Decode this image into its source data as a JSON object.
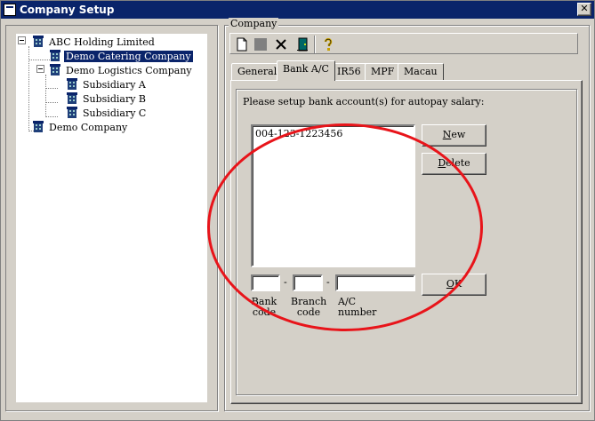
{
  "window": {
    "title": "Company Setup",
    "close_glyph": "✕",
    "colors": {
      "titlebar": "#0a246a",
      "face": "#d4d0c8",
      "annotation": "#e8141a"
    }
  },
  "tree": {
    "items": [
      {
        "label": "ABC Holding Limited",
        "icon": "building-icon",
        "expanded": true
      },
      {
        "label": "Demo Catering Company",
        "icon": "building-icon",
        "selected": true
      },
      {
        "label": "Demo Logistics Company",
        "icon": "building-icon",
        "expanded": true
      },
      {
        "label": "Subsidiary A",
        "icon": "building-icon"
      },
      {
        "label": "Subsidiary B",
        "icon": "building-icon"
      },
      {
        "label": "Subsidiary C",
        "icon": "building-icon"
      },
      {
        "label": "Demo Company",
        "icon": "building-icon"
      }
    ]
  },
  "company_group": {
    "label": "Company",
    "toolbar": [
      "new-document-icon",
      "save-icon",
      "delete-icon",
      "exit-door-icon",
      "help-key-icon"
    ]
  },
  "tabs": [
    {
      "label": "General"
    },
    {
      "label": "Bank A/C",
      "active": true
    },
    {
      "label": "IR56"
    },
    {
      "label": "MPF"
    },
    {
      "label": "Macau"
    }
  ],
  "bank": {
    "instruction": "Please setup bank account(s) for autopay salary:",
    "accounts": [
      "004-123-1223456"
    ],
    "new_button": {
      "accel": "N",
      "rest": "ew"
    },
    "delete_button": {
      "accel": "D",
      "rest": "elete"
    },
    "ok_button": {
      "accel": "O",
      "rest": "K"
    },
    "separator": "-",
    "bank_code_label": [
      "Bank",
      "code"
    ],
    "branch_code_label": [
      "Branch",
      "code"
    ],
    "ac_number_label": "A/C number",
    "bank_code_value": "",
    "branch_code_value": "",
    "ac_number_value": ""
  }
}
